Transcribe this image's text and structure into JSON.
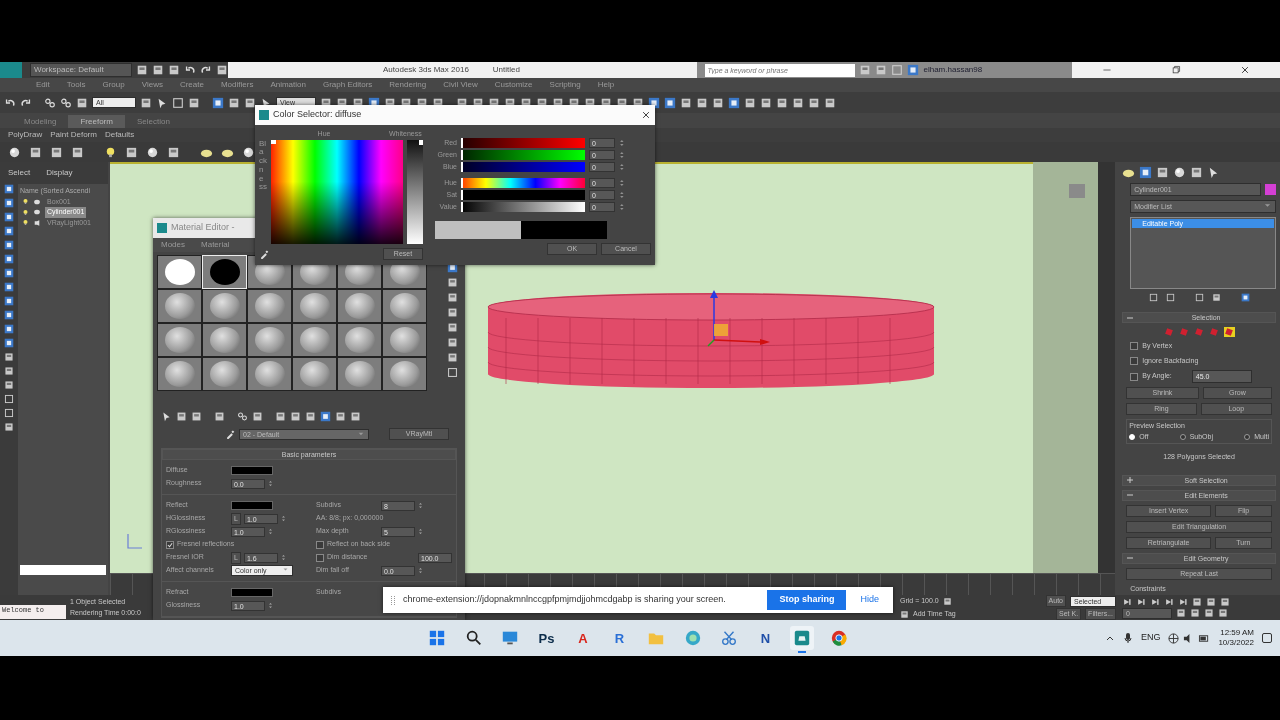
{
  "title_bar": {
    "workspace": "Workspace: Default",
    "app_title": "Autodesk 3ds Max 2016",
    "document": "Untitled",
    "search_placeholder": "Type a keyword or phrase",
    "user": "elham.hassan98"
  },
  "menu": [
    "Edit",
    "Tools",
    "Group",
    "Views",
    "Create",
    "Modifiers",
    "Animation",
    "Graph Editors",
    "Rendering",
    "Civil View",
    "Customize",
    "Scripting",
    "Help"
  ],
  "toolbar": {
    "selection_filter": "All",
    "view": "View"
  },
  "ribbon": {
    "tabs": [
      {
        "label": "Modeling",
        "selected": false
      },
      {
        "label": "Freeform",
        "selected": true
      },
      {
        "label": "Selection",
        "selected": false
      }
    ],
    "panels": [
      "PolyDraw",
      "Paint Deform",
      "Defaults"
    ]
  },
  "scene_explorer": {
    "tabs": [
      "Select",
      "Display"
    ],
    "header": "Name (Sorted Ascendi",
    "items": [
      {
        "name": "Box001",
        "kind": "object",
        "selected": false
      },
      {
        "name": "Cylinder001",
        "kind": "object",
        "selected": true
      },
      {
        "name": "VRayLight001",
        "kind": "light",
        "selected": false
      }
    ]
  },
  "command_panel": {
    "object": {
      "name": "Cylinder001",
      "color": "#d43fd4"
    },
    "modifier_list": "Modifier List",
    "stack": [
      {
        "label": "Editable Poly",
        "selected": true
      }
    ],
    "selection": {
      "title": "Selection",
      "expanded": true,
      "levels": [
        {
          "selected": false
        },
        {
          "selected": false
        },
        {
          "selected": false
        },
        {
          "selected": false
        },
        {
          "selected": true
        }
      ],
      "checks": [
        {
          "label": "By Vertex",
          "checked": false
        },
        {
          "label": "Ignore Backfacing",
          "checked": false
        },
        {
          "label": "By Angle:",
          "checked": false,
          "value": "45.0"
        }
      ],
      "buttons": [
        [
          "Shrink",
          "Grow"
        ],
        [
          "Ring",
          "Loop"
        ]
      ],
      "preview_title": "Preview Selection",
      "preview": [
        {
          "label": "Off",
          "selected": true
        },
        {
          "label": "SubObj",
          "selected": false
        },
        {
          "label": "Multi",
          "selected": false
        }
      ],
      "summary": "128 Polygons Selected"
    },
    "rollouts": [
      {
        "title": "Soft Selection",
        "expanded": false
      },
      {
        "title": "Edit Elements",
        "expanded": true,
        "buttons": [
          [
            "Insert Vertex",
            "Flip"
          ],
          [
            "Edit Triangulation"
          ],
          [
            "Retriangulate",
            "Turn"
          ]
        ]
      },
      {
        "title": "Edit Geometry",
        "expanded": true,
        "buttons": [
          [
            "Repeat Last"
          ]
        ]
      }
    ],
    "group": "Constraints"
  },
  "color_selector": {
    "title": "Color Selector: diffuse",
    "hue": {
      "label": "Hue",
      "level": 0
    },
    "whiteness": {
      "label": "Whiteness",
      "level": 0
    },
    "blackness": {
      "label": "Blackness"
    },
    "channels": [
      {
        "label": "Red",
        "kind": "red",
        "value": "0",
        "level": 0
      },
      {
        "label": "Green",
        "kind": "green",
        "value": "0",
        "level": 0
      },
      {
        "label": "Blue",
        "kind": "blue",
        "value": "0",
        "level": 0
      },
      {
        "label": "Hue",
        "kind": "hue",
        "value": "0",
        "level": 0
      },
      {
        "label": "Sat",
        "kind": "sat",
        "value": "0",
        "level": 0
      },
      {
        "label": "Value",
        "kind": "value",
        "value": "0",
        "level": 0
      }
    ],
    "swatches": [
      {
        "color": "#c0c0c0"
      },
      {
        "color": "#000000"
      }
    ],
    "buttons": [
      "Reset",
      "OK",
      "Cancel"
    ]
  },
  "material_editor": {
    "title": "Material Editor -",
    "menu": [
      "Modes",
      "Material"
    ],
    "slots": [
      {
        "color": "#ffffff",
        "selected": false
      },
      {
        "color": "#000000",
        "selected": true
      },
      {
        "color": "#9a9a9a",
        "selected": false
      },
      {
        "color": "#9a9a9a",
        "selected": false
      },
      {
        "color": "#9a9a9a",
        "selected": false
      },
      {
        "color": "#9a9a9a",
        "selected": false
      },
      {
        "color": "#9a9a9a",
        "selected": false
      },
      {
        "color": "#9a9a9a",
        "selected": false
      },
      {
        "color": "#9a9a9a",
        "selected": false
      },
      {
        "color": "#9a9a9a",
        "selected": false
      },
      {
        "color": "#9a9a9a",
        "selected": false
      },
      {
        "color": "#9a9a9a",
        "selected": false
      },
      {
        "color": "#9a9a9a",
        "selected": false
      },
      {
        "color": "#9a9a9a",
        "selected": false
      },
      {
        "color": "#9a9a9a",
        "selected": false
      },
      {
        "color": "#9a9a9a",
        "selected": false
      },
      {
        "color": "#9a9a9a",
        "selected": false
      },
      {
        "color": "#9a9a9a",
        "selected": false
      },
      {
        "color": "#9a9a9a",
        "selected": false
      },
      {
        "color": "#9a9a9a",
        "selected": false
      },
      {
        "color": "#9a9a9a",
        "selected": false
      },
      {
        "color": "#9a9a9a",
        "selected": false
      },
      {
        "color": "#9a9a9a",
        "selected": false
      },
      {
        "color": "#9a9a9a",
        "selected": false
      }
    ],
    "material_name": "02 - Default",
    "material_type": "VRayMtl",
    "rollout_title": "Basic parameters",
    "sections": [
      {
        "left": [
          {
            "kind": "swatch",
            "label": "Diffuse"
          },
          {
            "kind": "spinner",
            "label": "Roughness",
            "value": "0.0"
          }
        ]
      },
      {
        "left": [
          {
            "kind": "swatch",
            "label": "Reflect"
          },
          {
            "kind": "spinner",
            "label": "HGlossiness",
            "lock": "L",
            "value": "1.0"
          },
          {
            "kind": "spinner",
            "label": "RGlossiness",
            "value": "1.0"
          },
          {
            "kind": "check",
            "label": "Fresnel reflections",
            "checked": true
          },
          {
            "kind": "spinner",
            "label": "Fresnel IOR",
            "lock": "L",
            "value": "1.6"
          },
          {
            "kind": "dropdown",
            "label": "Affect channels",
            "value": "Color only"
          }
        ],
        "right": [
          {
            "kind": "spinner",
            "label": "Subdivs",
            "value": "8"
          },
          {
            "kind": "note",
            "label": "AA: 8/8; px: 0,000000"
          },
          {
            "kind": "spinner",
            "label": "Max depth",
            "value": "5"
          },
          {
            "kind": "check",
            "label": "Reflect on back side",
            "checked": false
          },
          {
            "kind": "check",
            "label": "Dim distance",
            "checked": false,
            "value": "100.0"
          },
          {
            "kind": "spinner",
            "label": "Dim fall off",
            "value": "0.0"
          }
        ]
      },
      {
        "left": [
          {
            "kind": "swatch",
            "label": "Refract"
          },
          {
            "kind": "spinner",
            "label": "Glossiness",
            "value": "1.0"
          }
        ],
        "right": [
          {
            "kind": "note",
            "label": "Subdivs"
          }
        ]
      }
    ]
  },
  "status_bar": {
    "listener": "Welcome to",
    "prompt": "1 Object Selected",
    "render_time": "Rendering Time 0:00:0",
    "grid": "Grid = 100.0",
    "auto_key": "Auto",
    "key_mode": "Selected",
    "set_key": "Set K.",
    "filters": "Filters...",
    "time_tag": "Add Time Tag",
    "frame": "0"
  },
  "share_bar": {
    "message": "chrome-extension://jdopnakmnlnccgpfpmjmdjjohmcdgabp is sharing your screen.",
    "stop": "Stop sharing",
    "hide": "Hide"
  },
  "taskbar": {
    "apps": [
      {
        "kind": "windows",
        "active": false
      },
      {
        "kind": "search",
        "active": false
      },
      {
        "kind": "monitor",
        "active": false
      },
      {
        "kind": "letter",
        "glyph": "Ps",
        "color": "#0b2c4a",
        "active": false
      },
      {
        "kind": "letter",
        "glyph": "A",
        "color": "#d9261c",
        "active": false
      },
      {
        "kind": "letter",
        "glyph": "R",
        "color": "#2a6fd6",
        "active": false
      },
      {
        "kind": "folder",
        "active": false
      },
      {
        "kind": "swirl",
        "active": false
      },
      {
        "kind": "scissors",
        "active": false
      },
      {
        "kind": "letter",
        "glyph": "N",
        "color": "#1f4fa8",
        "active": false
      },
      {
        "kind": "max",
        "active": true
      },
      {
        "kind": "chrome",
        "active": false
      }
    ],
    "language": "ENG",
    "time": "12:59 AM",
    "date": "10/3/2022"
  }
}
